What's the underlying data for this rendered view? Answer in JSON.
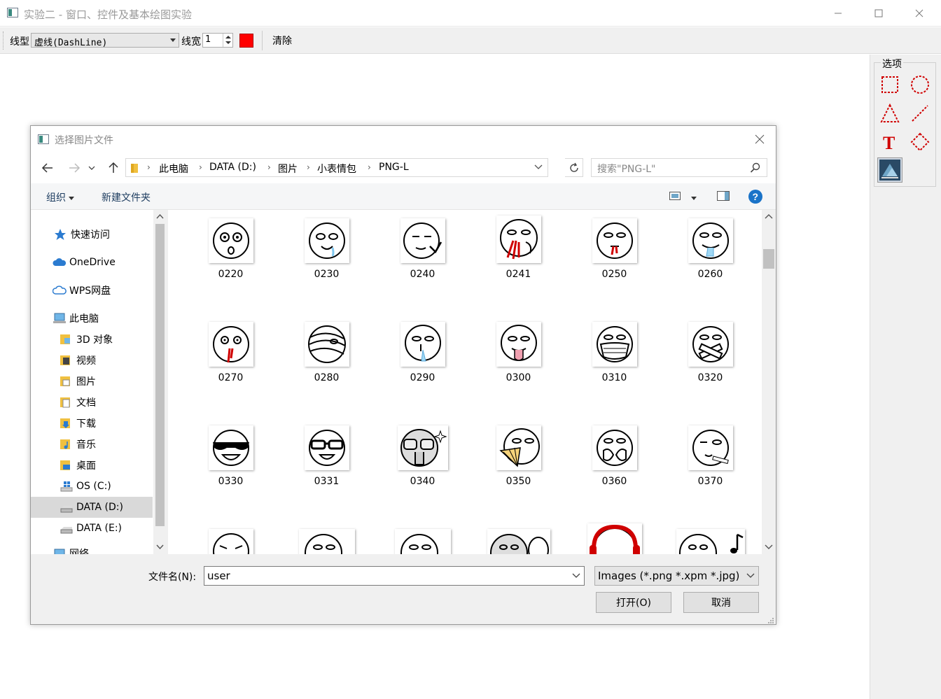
{
  "main_window": {
    "title": "实验二 - 窗口、控件及基本绘图实验",
    "toolbar": {
      "line_style_label": "线型",
      "line_style_value": "虚线(DashLine)",
      "line_width_label": "线宽",
      "line_width_value": "1",
      "color": "#ff0000",
      "clear_label": "清除"
    },
    "dock": {
      "title": "选项",
      "tools": [
        "rectangle-tool",
        "ellipse-tool",
        "triangle-tool",
        "line-tool",
        "text-tool",
        "diamond-tool",
        "image-tool"
      ]
    }
  },
  "dialog": {
    "title": "选择图片文件",
    "breadcrumb": [
      "此电脑",
      "DATA (D:)",
      "图片",
      "小表情包",
      "PNG-L"
    ],
    "search_placeholder": "搜索\"PNG-L\"",
    "commands": {
      "organize": "组织",
      "new_folder": "新建文件夹"
    },
    "nav_items": [
      {
        "label": "快速访问",
        "icon": "star-icon"
      },
      {
        "label": "OneDrive",
        "icon": "cloud-icon"
      },
      {
        "label": "WPS网盘",
        "icon": "cloud-icon"
      },
      {
        "label": "此电脑",
        "icon": "computer-icon"
      },
      {
        "label": "3D 对象",
        "icon": "folder-3d-icon"
      },
      {
        "label": "视频",
        "icon": "folder-video-icon"
      },
      {
        "label": "图片",
        "icon": "folder-pictures-icon"
      },
      {
        "label": "文档",
        "icon": "folder-documents-icon"
      },
      {
        "label": "下载",
        "icon": "folder-downloads-icon"
      },
      {
        "label": "音乐",
        "icon": "folder-music-icon"
      },
      {
        "label": "桌面",
        "icon": "folder-desktop-icon"
      },
      {
        "label": "OS (C:)",
        "icon": "windows-drive-icon"
      },
      {
        "label": "DATA (D:)",
        "icon": "drive-icon"
      },
      {
        "label": "DATA (E:)",
        "icon": "drive-icon"
      },
      {
        "label": "网络",
        "icon": "network-icon"
      }
    ],
    "files": [
      "0220",
      "0230",
      "0240",
      "0241",
      "0250",
      "0260",
      "0270",
      "0280",
      "0290",
      "0300",
      "0310",
      "0320",
      "0330",
      "0331",
      "0340",
      "0350",
      "0360",
      "0370",
      "",
      "",
      "",
      "",
      "",
      ""
    ],
    "filename_label": "文件名(N):",
    "filename_value": "user",
    "filter_value": "Images (*.png *.xpm *.jpg)",
    "open_label": "打开(O)",
    "cancel_label": "取消"
  },
  "colors": {
    "selection": "#cce8ff",
    "tool_red": "#d00000",
    "help_blue": "#1a73c8"
  }
}
